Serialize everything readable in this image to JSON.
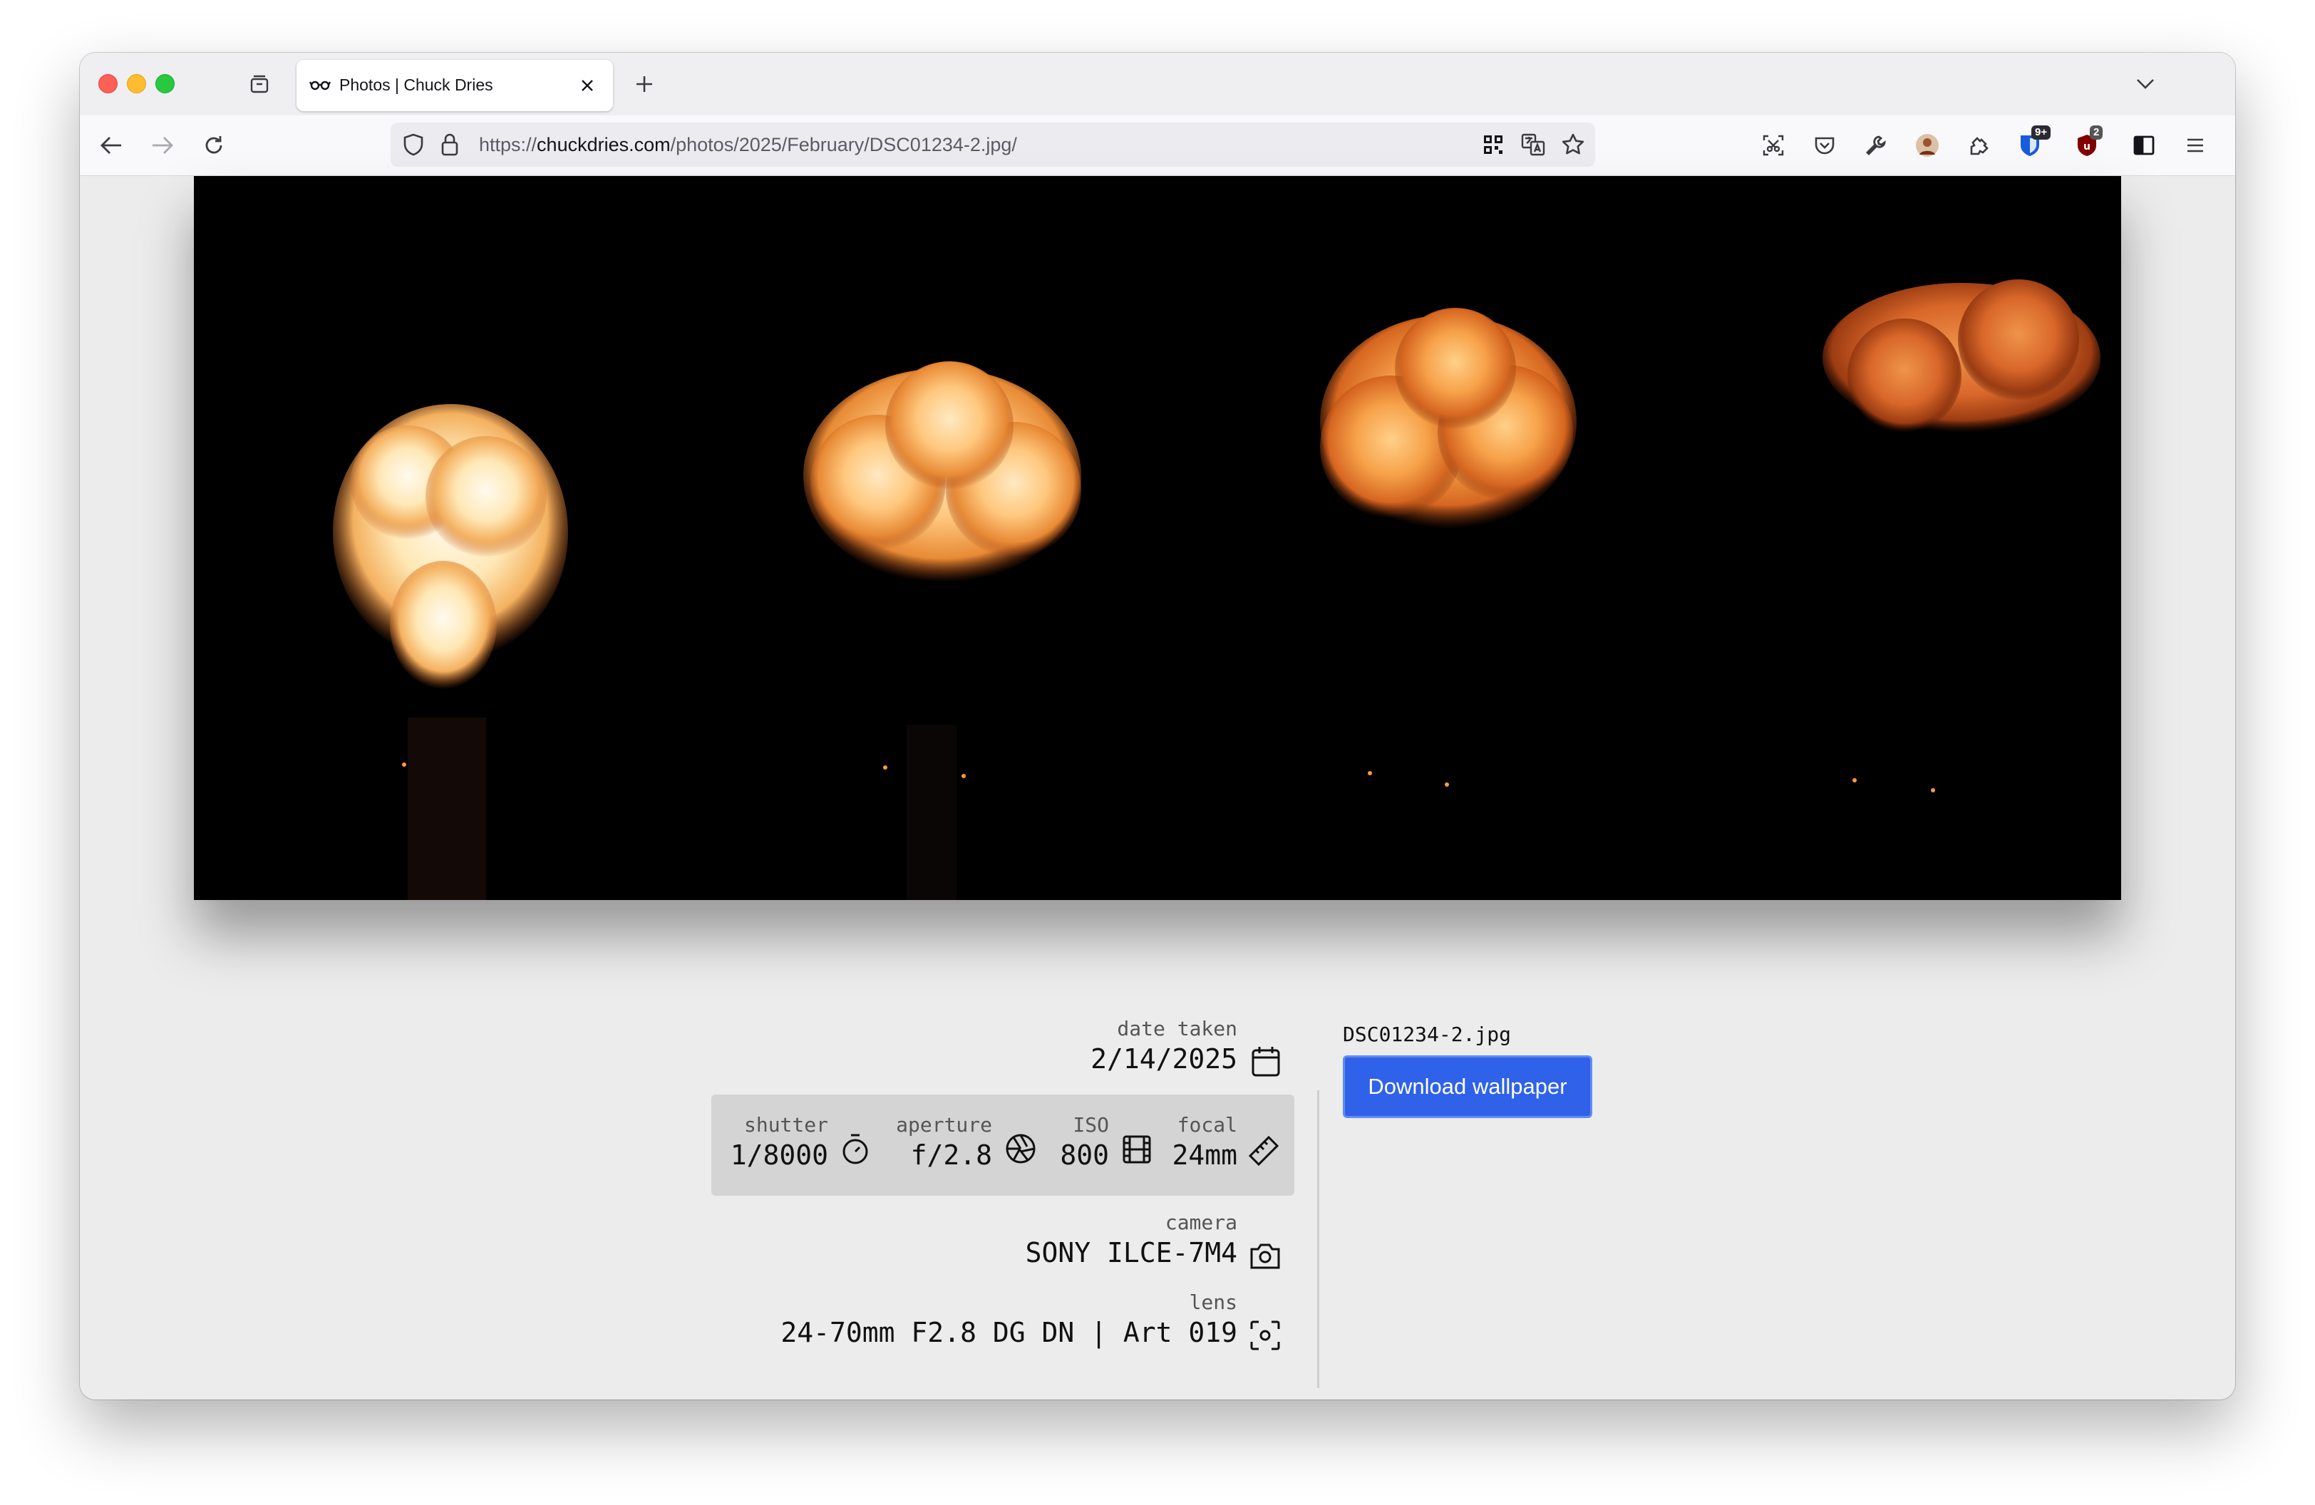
{
  "browser": {
    "tab": {
      "title": "Photos | Chuck Dries",
      "favicon": "glasses-icon"
    },
    "url": {
      "scheme": "https://",
      "host": "chuckdries.com",
      "path": "/photos/2025/February/DSC01234-2.jpg/"
    },
    "badges": {
      "bitwarden": "9+",
      "ublock": "2"
    }
  },
  "photo": {
    "alt": "Four fireballs against a black night sky"
  },
  "metadata": {
    "date_taken": {
      "label": "date taken",
      "value": "2/14/2025"
    },
    "shutter": {
      "label": "shutter",
      "value": "1/8000"
    },
    "aperture": {
      "label": "aperture",
      "value": "f/2.8"
    },
    "iso": {
      "label": "ISO",
      "value": "800"
    },
    "focal": {
      "label": "focal",
      "value": "24mm"
    },
    "camera": {
      "label": "camera",
      "value": "SONY ILCE-7M4"
    },
    "lens": {
      "label": "lens",
      "value": "24-70mm F2.8 DG DN | Art 019"
    }
  },
  "file": {
    "name": "DSC01234-2.jpg",
    "download_label": "Download wallpaper"
  },
  "colors": {
    "accent": "#2f62e8",
    "page_bg": "#ececec",
    "exif_bg": "#d4d4d4"
  }
}
